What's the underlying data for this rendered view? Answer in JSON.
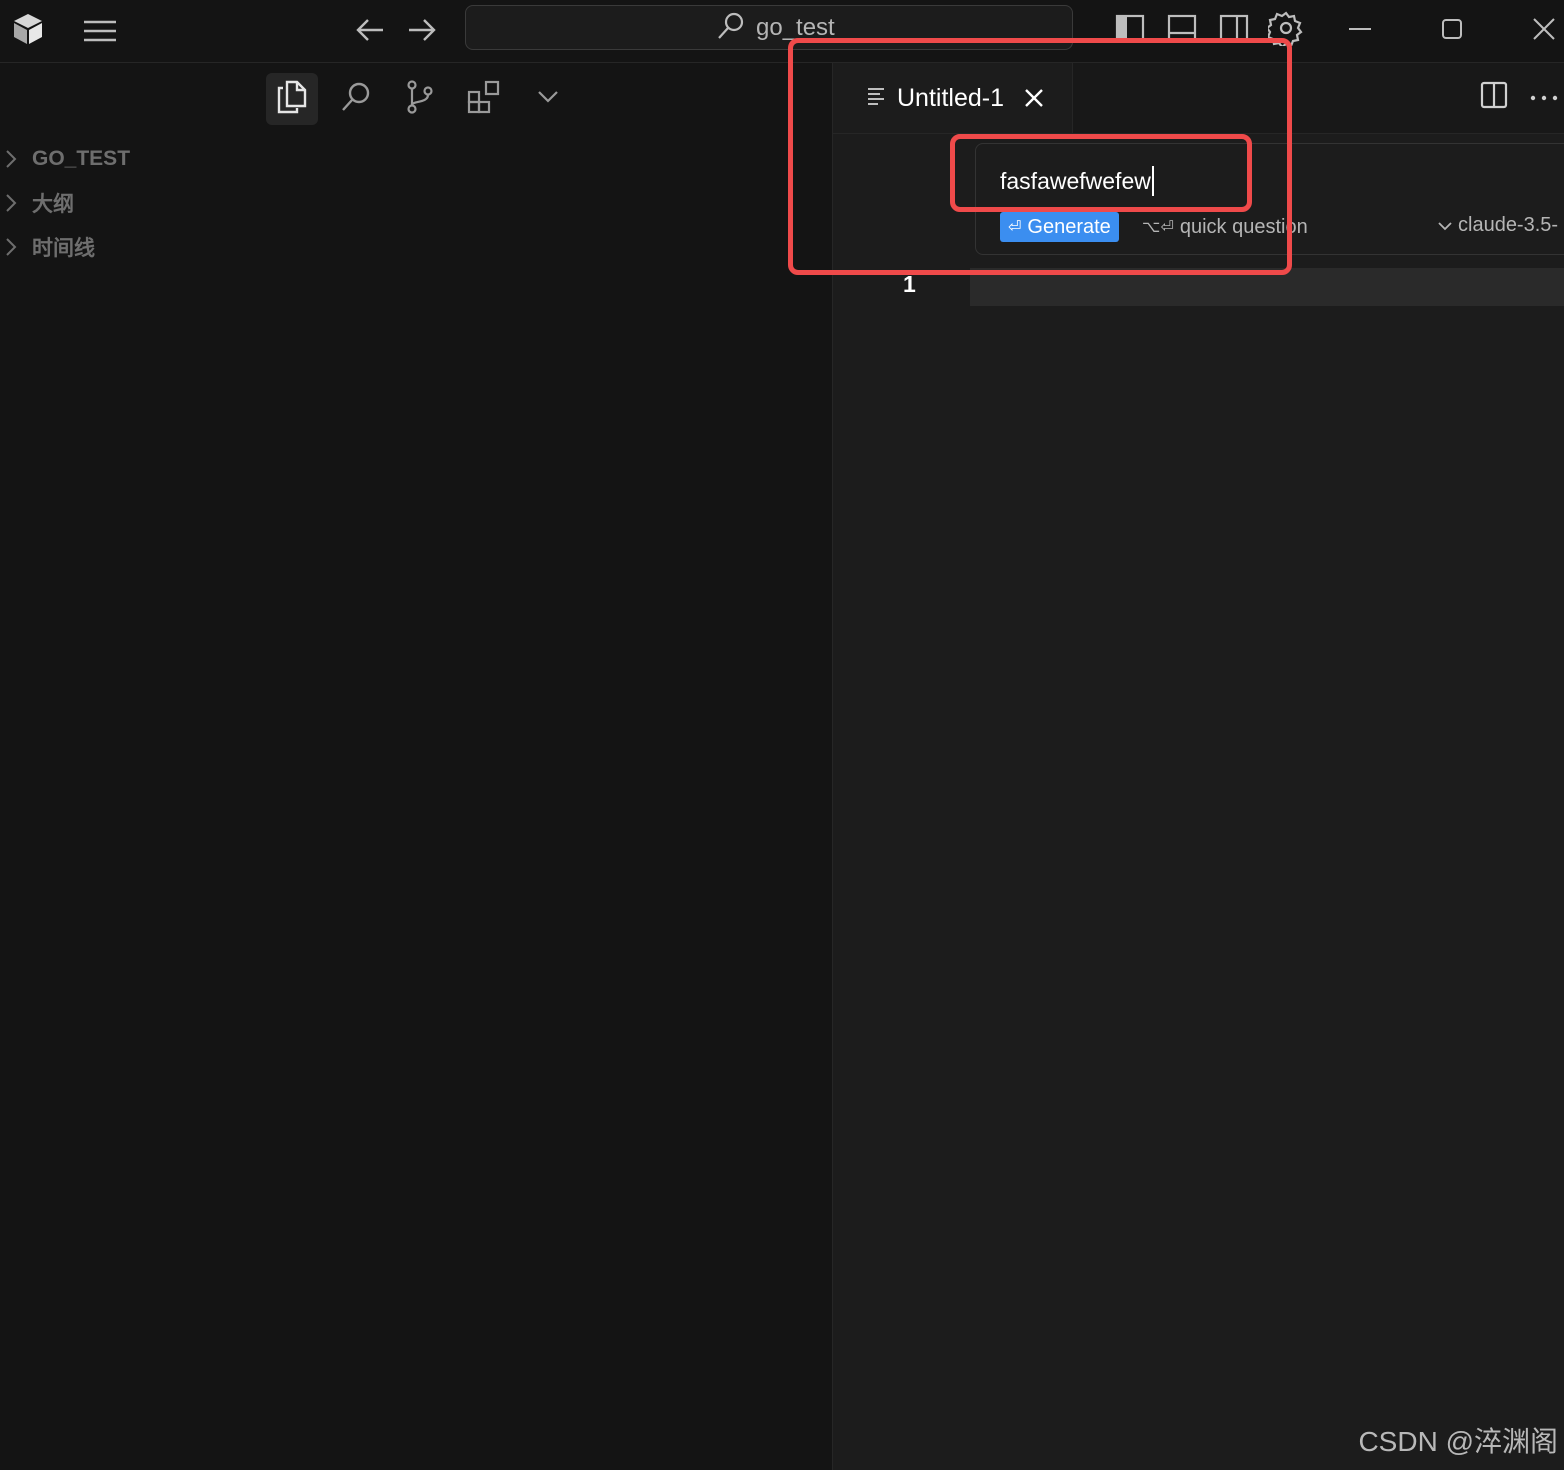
{
  "titlebar": {
    "search_text": "go_test"
  },
  "sidebar": {
    "tree": [
      {
        "label": "GO_TEST"
      },
      {
        "label": "大纲"
      },
      {
        "label": "时间线"
      }
    ]
  },
  "editor": {
    "tab": {
      "title": "Untitled-1"
    },
    "prompt": {
      "input_value": "fasfawefwefew",
      "generate_label": "Generate",
      "generate_shortcut": "⏎",
      "quick_label": "quick question",
      "quick_shortcut": "⌥⏎",
      "model": "claude-3.5-"
    },
    "line_number": "1"
  },
  "watermark": "CSDN @淬渊阁",
  "colors": {
    "accent": "#3b8ef0",
    "annotation": "#ef4a4a"
  }
}
